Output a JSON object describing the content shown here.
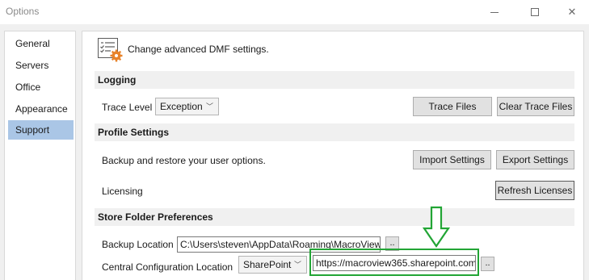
{
  "window": {
    "title": "Options"
  },
  "sidebar": {
    "items": [
      {
        "label": "General"
      },
      {
        "label": "Servers"
      },
      {
        "label": "Office"
      },
      {
        "label": "Appearance"
      },
      {
        "label": "Support",
        "selected": true
      }
    ]
  },
  "header": {
    "icon": "settings-checklist-gear-icon",
    "text": "Change advanced DMF settings."
  },
  "logging": {
    "title": "Logging",
    "trace_level_label": "Trace Level",
    "trace_level_value": "Exception",
    "trace_files_button": "Trace Files",
    "clear_trace_files_button": "Clear Trace Files"
  },
  "profile": {
    "title": "Profile Settings",
    "backup_text": "Backup and restore your user options.",
    "import_button": "Import Settings",
    "export_button": "Export Settings",
    "licensing_label": "Licensing",
    "refresh_button": "Refresh Licenses"
  },
  "store": {
    "title": "Store Folder Preferences",
    "backup_label": "Backup Location",
    "backup_value": "C:\\Users\\steven\\AppData\\Roaming\\MacroView",
    "browse_label": "..",
    "central_label": "Central Configuration Location",
    "central_type": "SharePoint",
    "central_value": "https://macroview365.sharepoint.com",
    "central_browse_label": ".."
  },
  "colors": {
    "selection": "#aac6e6",
    "annotation": "#22a535"
  }
}
